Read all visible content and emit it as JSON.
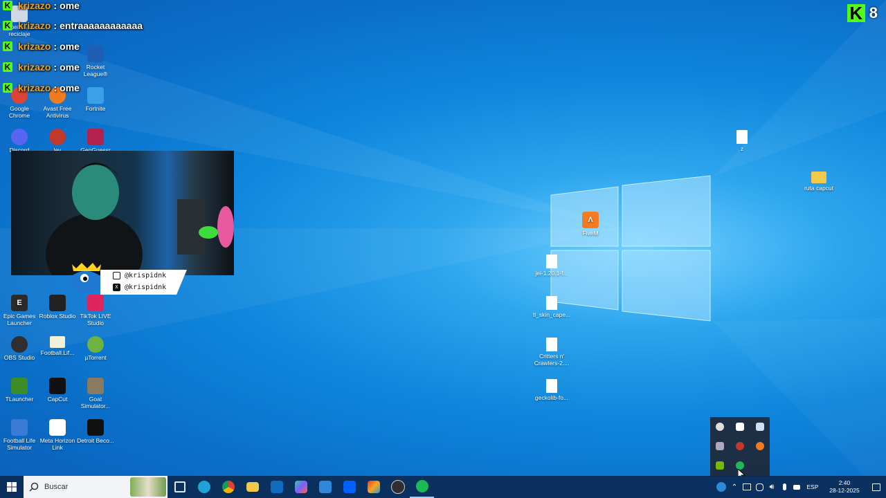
{
  "desktop": {
    "icons": [
      {
        "label": "Papelera de reciclaje",
        "color": "#cfd8e3"
      },
      {
        "label": "Rocket League®",
        "color": "#1e5fb5"
      },
      {
        "label": "Google Chrome",
        "color": "#db4437"
      },
      {
        "label": "Avast Free Antivirus",
        "color": "#f07c22"
      },
      {
        "label": "Fortnite",
        "color": "#3aa0e8"
      },
      {
        "label": "Discord",
        "color": "#5865f2"
      },
      {
        "label": "lev",
        "color": "#c0392b"
      },
      {
        "label": "GeoGuessr",
        "color": "#b42050"
      },
      {
        "label": "Epic Games Launcher",
        "color": "#2b2b2b"
      },
      {
        "label": "Roblox Studio",
        "color": "#222222"
      },
      {
        "label": "TikTok LIVE Studio",
        "color": "#e0245e"
      },
      {
        "label": "OBS Studio",
        "color": "#302e31"
      },
      {
        "label": "Football.Lif...",
        "color": "#f2c94c"
      },
      {
        "label": "µTorrent",
        "color": "#6cb33f"
      },
      {
        "label": "TLauncher",
        "color": "#3c8c28"
      },
      {
        "label": "CapCut",
        "color": "#111111"
      },
      {
        "label": "Goat Simulator...",
        "color": "#8a7a60"
      },
      {
        "label": "Football Life Simulator",
        "color": "#3a7bd5"
      },
      {
        "label": "Meta Horizon Link",
        "color": "#ffffff"
      },
      {
        "label": "Detroit Beco...",
        "color": "#111111"
      },
      {
        "label": "z",
        "color": "#ffffff"
      },
      {
        "label": "ruta capcut",
        "color": "#f2c94c"
      },
      {
        "label": "FiveM",
        "color": "#f47b20"
      },
      {
        "label": "jei-1.20.1-f...",
        "color": "#ffffff"
      },
      {
        "label": "tl_skin_cape...",
        "color": "#ffffff"
      },
      {
        "label": "Critters n' Crawlers-2....",
        "color": "#ffffff"
      },
      {
        "label": "geckolib-fo...",
        "color": "#ffffff"
      }
    ]
  },
  "chat": {
    "badge": "K",
    "messages": [
      {
        "user": "krizazo",
        "sep": ":",
        "text": "ome"
      },
      {
        "user": "krizazo",
        "sep": ":",
        "text": "entraaaaaaaaaaaa"
      },
      {
        "user": "krizazo",
        "sep": ":",
        "text": "ome"
      },
      {
        "user": "krizazo",
        "sep": ":",
        "text": "ome"
      },
      {
        "user": "krizazo",
        "sep": ":",
        "text": "ome"
      }
    ]
  },
  "overlay": {
    "kick_logo": "K",
    "viewer_count": "8",
    "social": [
      {
        "icon": "instagram-icon",
        "handle": "@krispidnk"
      },
      {
        "icon": "x-icon",
        "handle": "@krispidnk"
      }
    ]
  },
  "taskbar": {
    "search_placeholder": "Buscar",
    "language": "ESP",
    "time": "2:40",
    "date": "28-12-2025",
    "apps": [
      {
        "name": "task-view",
        "color": "#dfe8f5"
      },
      {
        "name": "edge",
        "color": "#1fa2d8"
      },
      {
        "name": "chrome",
        "color": "#db4437"
      },
      {
        "name": "file-explorer",
        "color": "#f2c94c"
      },
      {
        "name": "outlook",
        "color": "#0f6cbd"
      },
      {
        "name": "copilot",
        "color": "#7c5cff"
      },
      {
        "name": "store",
        "color": "#2f89d8"
      },
      {
        "name": "dropbox",
        "color": "#0061fe"
      },
      {
        "name": "office",
        "color": "#ea3e23"
      },
      {
        "name": "obs",
        "color": "#302e31"
      },
      {
        "name": "spotify",
        "color": "#1db954"
      }
    ]
  }
}
